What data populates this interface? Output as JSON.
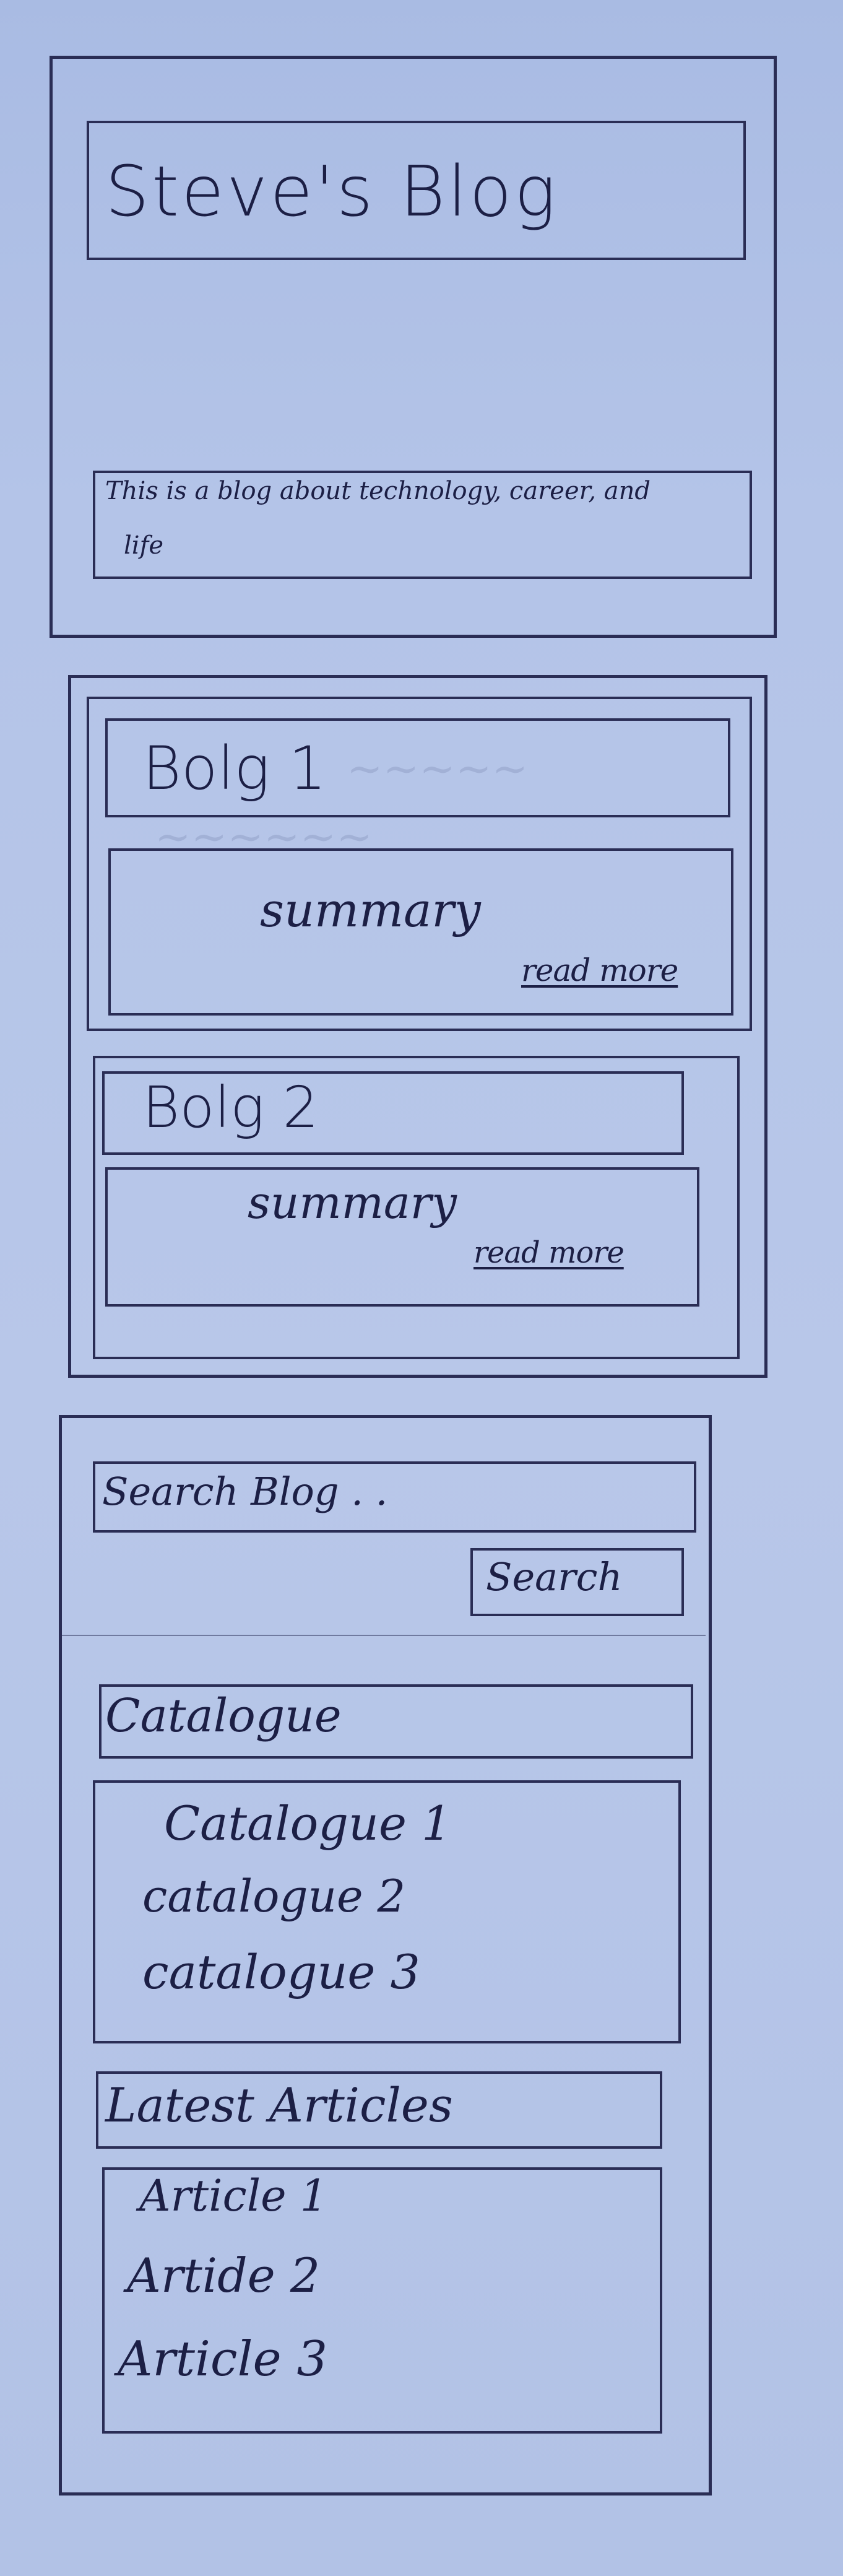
{
  "header": {
    "title": "Steve's Blog",
    "tagline_line1": "This is a blog about technology, career, and",
    "tagline_line2": "life"
  },
  "posts": [
    {
      "title": "Bolg 1",
      "summary": "summary",
      "read_more": "read more"
    },
    {
      "title": "Bolg 2",
      "summary": "summary",
      "read_more": "read more"
    }
  ],
  "sidebar": {
    "search_placeholder": "Search Blog . .",
    "search_button": "Search",
    "catalogue_heading": "Catalogue",
    "catalogue_items": [
      "Catalogue 1",
      "catalogue 2",
      "catalogue 3"
    ],
    "latest_heading": "Latest Articles",
    "latest_items": [
      "Article 1",
      "Artide 2",
      "Article 3"
    ]
  }
}
